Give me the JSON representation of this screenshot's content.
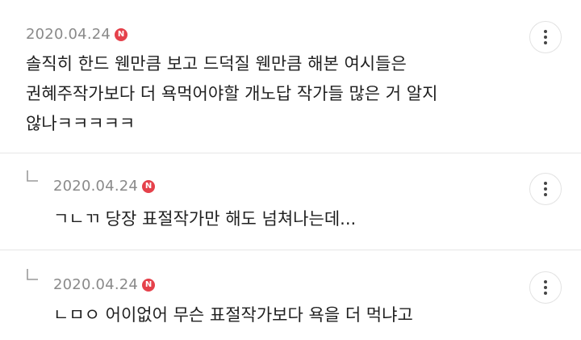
{
  "comments": [
    {
      "date": "2020.04.24",
      "badge": "N",
      "lines": [
        "솔직히 한드 웬만큼 보고 드덕질 웬만큼 해본 여시들은",
        "권혜주작가보다 더 욕먹어야할 개노답 작가들 많은 거 알지",
        "않나ㅋㅋㅋㅋㅋ"
      ],
      "more_icon": "more-vertical-icon"
    },
    {
      "date": "2020.04.24",
      "badge": "N",
      "lines": [
        "ㄱㄴㄲ 당장 표절작가만 해도 넘쳐나는데..."
      ],
      "reply_icon": "reply-arrow-icon",
      "more_icon": "more-vertical-icon"
    },
    {
      "date": "2020.04.24",
      "badge": "N",
      "lines": [
        "ㄴㅁㅇ 어이없어 무슨 표절작가보다 욕을 더 먹냐고"
      ],
      "reply_icon": "reply-arrow-icon",
      "more_icon": "more-vertical-icon"
    }
  ],
  "colors": {
    "badge": "#e5414b",
    "date": "#8a8a8a",
    "divider": "#e6e6e6"
  }
}
